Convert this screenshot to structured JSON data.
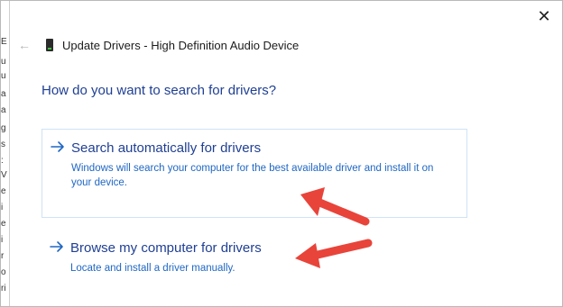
{
  "window": {
    "close_label": "✕",
    "back_label": "←",
    "title": "Update Drivers - High Definition Audio Device"
  },
  "heading": "How do you want to search for drivers?",
  "options": [
    {
      "title": "Search automatically for drivers",
      "description": "Windows will search your computer for the best available driver and install it on your device."
    },
    {
      "title": "Browse my computer for drivers",
      "description": "Locate and install a driver manually."
    }
  ],
  "colors": {
    "accent": "#1f67c4",
    "heading": "#1f3f93",
    "annotation_arrow": "#e8443a"
  },
  "icons": {
    "close": "close-icon",
    "back": "back-arrow-icon",
    "device": "audio-device-icon",
    "option_arrow": "right-arrow-icon",
    "annotation": "red-pointer-arrow"
  }
}
